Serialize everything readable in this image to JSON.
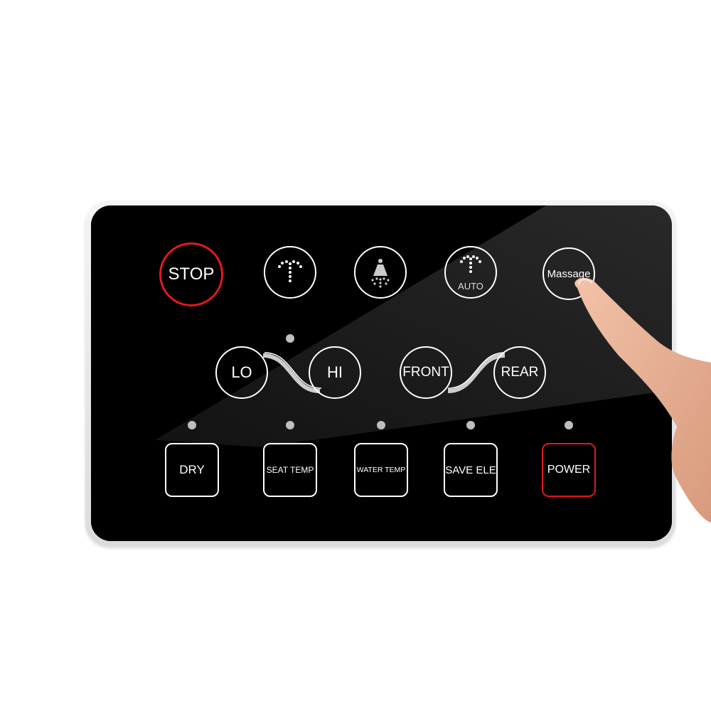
{
  "panel": {
    "accent_red": "#e21a1a",
    "top_row": [
      {
        "label": "STOP",
        "style": "red"
      },
      {
        "icon": "rear-wash-spray-icon"
      },
      {
        "icon": "feminine-wash-icon"
      },
      {
        "icon": "auto-wash-spray-icon",
        "label": "AUTO"
      },
      {
        "label": "Massage"
      }
    ],
    "middle_row": [
      {
        "label": "LO"
      },
      {
        "label": "HI"
      },
      {
        "label": "FRONT"
      },
      {
        "label": "REAR"
      }
    ],
    "bottom_row": [
      {
        "label": "DRY"
      },
      {
        "label": "SEAT TEMP"
      },
      {
        "label": "WATER TEMP"
      },
      {
        "label": "SAVE ELE"
      },
      {
        "label": "POWER",
        "style": "red"
      }
    ]
  }
}
